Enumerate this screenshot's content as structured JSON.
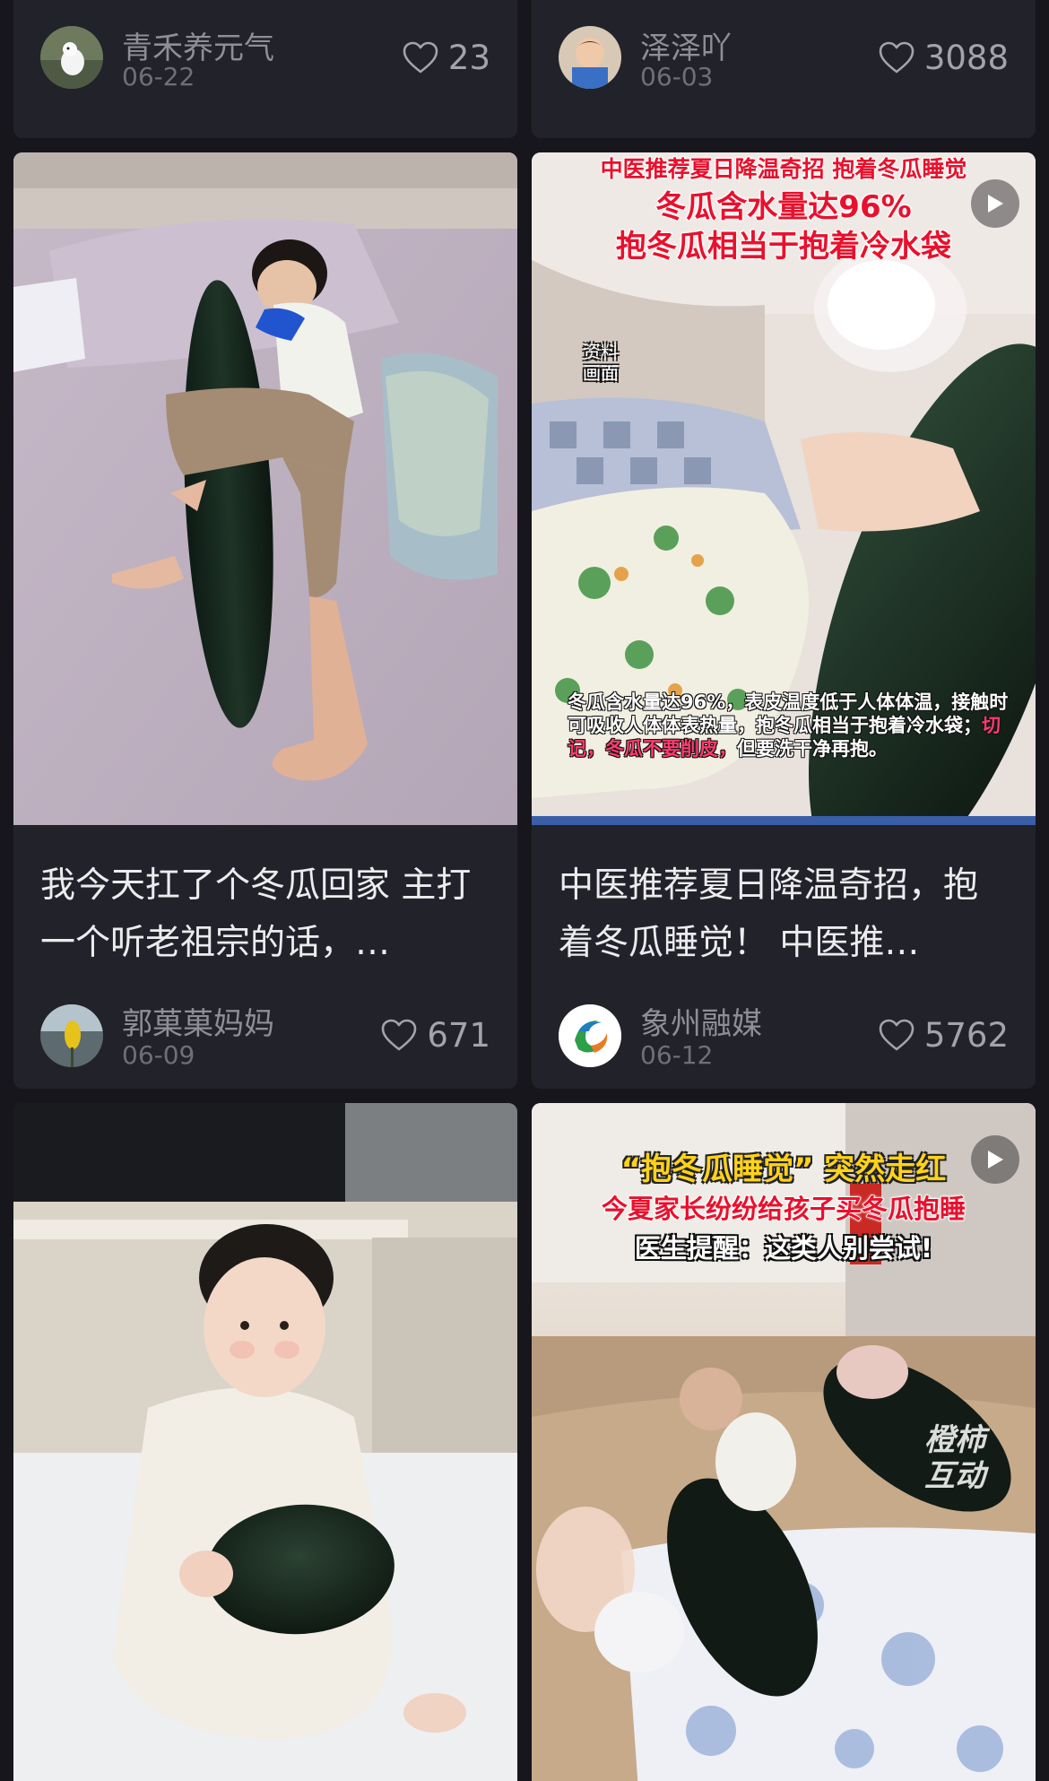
{
  "feed": {
    "left": [
      {
        "kind": "footer-only",
        "author": "青禾养元气",
        "date": "06-22",
        "likes": "23",
        "avatar_icon": "avatar-white-bird",
        "has_title": false
      },
      {
        "kind": "post",
        "image_description_name": "boy-hugging-winter-melon-photo",
        "title": "我今天扛了个冬瓜回家 主打一个听老祖宗的话，…",
        "author": "郭菓菓妈妈",
        "date": "06-09",
        "likes": "671",
        "avatar_icon": "avatar-yellow-flower"
      },
      {
        "kind": "post",
        "image_description_name": "baby-holding-winter-melon-photo"
      }
    ],
    "right": [
      {
        "kind": "footer-only",
        "author": "泽泽吖",
        "date": "06-03",
        "likes": "3088",
        "avatar_icon": "avatar-child-photo"
      },
      {
        "kind": "post",
        "image_description_name": "tcm-winter-melon-video-thumbnail",
        "overlay": {
          "headline": "中医推荐夏日降温奇招 抱着冬瓜睡觉",
          "line1": "冬瓜含水量达96%",
          "line2": "抱冬瓜相当于抱着冷水袋",
          "stamp": "资料\n画面",
          "caption_main": "冬瓜含水量达96%，表皮温度低于人体体温，接触时可吸收人体体表热量，抱冬瓜相当于抱着冷水袋；",
          "caption_warn": "切记，冬瓜不要削皮，",
          "caption_end": "但要洗干净再抱。"
        },
        "title": "中医推荐夏日降温奇招，抱着冬瓜睡觉！ 中医推…",
        "author": "象州融媒",
        "date": "06-12",
        "likes": "5762",
        "avatar_icon": "avatar-green-swirl-logo"
      },
      {
        "kind": "post",
        "image_description_name": "babies-sleeping-with-winter-melons-video-thumbnail",
        "overlay": {
          "line1": "“抱冬瓜睡觉” 突然走红",
          "line2": "今夏家长纷纷给孩子买冬瓜抱睡",
          "line3": "医生提醒：这类人别尝试!",
          "watermark": "橙柿\n互动"
        }
      }
    ]
  },
  "colors": {
    "background": "#16161c",
    "card": "#22222a",
    "title_text": "#ececef",
    "meta_text": "#8e8e96",
    "overlay_red": "#e8112d",
    "overlay_yellow": "#ffd21a"
  }
}
